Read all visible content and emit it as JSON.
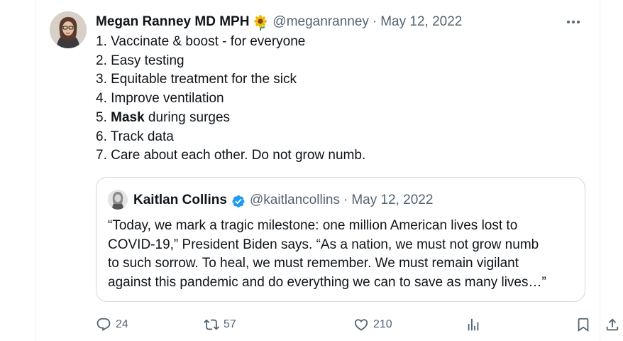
{
  "tweet": {
    "author_name": "Megan Ranney MD MPH",
    "emoji_icon": "sunflower-emoji",
    "handle": "@meganranney",
    "separator": "·",
    "date": "May 12, 2022",
    "more_icon": "more-horizontal-icon",
    "lines": [
      {
        "prefix": "1. Vaccinate & boost - for everyone",
        "bold": "",
        "suffix": ""
      },
      {
        "prefix": "2. Easy testing",
        "bold": "",
        "suffix": ""
      },
      {
        "prefix": "3. Equitable treatment for the sick",
        "bold": "",
        "suffix": ""
      },
      {
        "prefix": "4. Improve ventilation",
        "bold": "",
        "suffix": ""
      },
      {
        "prefix": "5. ",
        "bold": "Mask",
        "suffix": " during surges"
      },
      {
        "prefix": "6. Track data",
        "bold": "",
        "suffix": ""
      },
      {
        "prefix": "7. Care about each other. Do not grow numb.",
        "bold": "",
        "suffix": ""
      }
    ]
  },
  "quoted_tweet": {
    "author_name": "Kaitlan Collins",
    "verified_icon": "verified-badge-icon",
    "handle": "@kaitlancollins",
    "separator": "·",
    "date": "May 12, 2022",
    "lines": [
      "“Today, we mark a tragic milestone: one million American lives lost to",
      "COVID-19,” President Biden says. “As a nation, we must not grow numb",
      "to such sorrow. To heal, we must remember. We must remain vigilant",
      "against this pandemic and do everything we can to save as many lives…”"
    ]
  },
  "actions": {
    "reply": {
      "icon": "reply-icon",
      "count": "24"
    },
    "retweet": {
      "icon": "retweet-icon",
      "count": "57"
    },
    "like": {
      "icon": "heart-icon",
      "count": "210"
    },
    "views": {
      "icon": "views-chart-icon"
    },
    "bookmark": {
      "icon": "bookmark-icon"
    },
    "share": {
      "icon": "share-icon"
    }
  },
  "colors": {
    "text_primary": "#0f1419",
    "text_secondary": "#536471",
    "border": "#cfd9de",
    "verified_blue": "#1d9bf0"
  }
}
